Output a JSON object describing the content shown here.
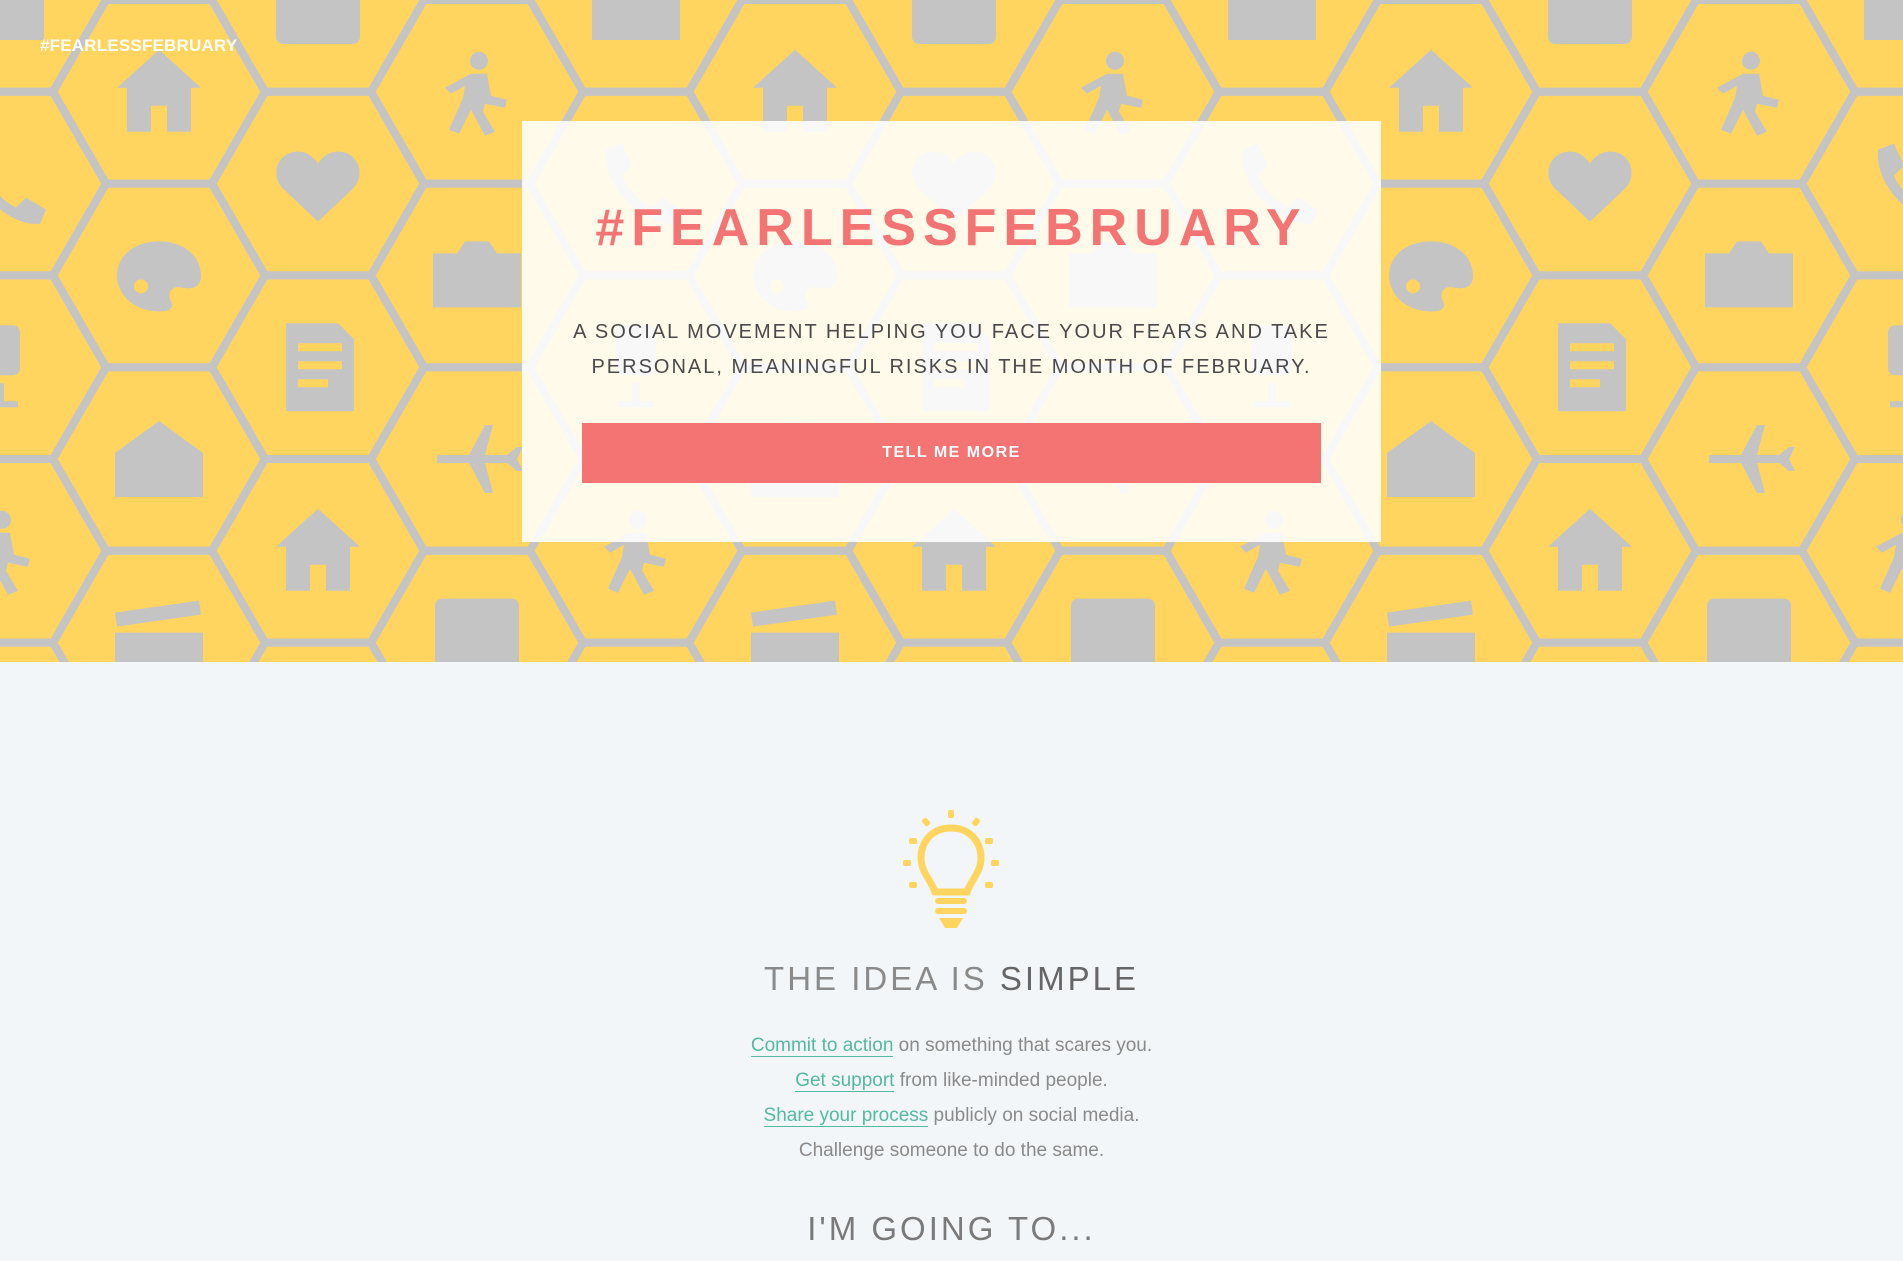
{
  "brand": "#FEARLESSFEBRUARY",
  "hero": {
    "title": "#FEARLESSFEBRUARY",
    "tagline": "A social movement helping you face your fears and take personal, meaningful risks in the month of February.",
    "cta": "TELL ME MORE",
    "pattern_icons": [
      "airplane-icon",
      "palette-icon",
      "walking-person-icon",
      "document-icon",
      "phone-icon",
      "music-note-icon",
      "envelope-icon",
      "camera-icon",
      "house-icon",
      "microphone-icon",
      "heart-icon",
      "clapperboard-icon"
    ]
  },
  "idea": {
    "heading_light": "THE IDEA IS",
    "heading_strong": "SIMPLE",
    "steps": [
      {
        "link": "Commit to action",
        "rest": " on something that scares you."
      },
      {
        "link": "Get support",
        "rest": " from like-minded people."
      },
      {
        "link": "Share your process",
        "rest": " publicly on social media."
      },
      {
        "link": "",
        "rest": "Challenge someone to do the same."
      }
    ],
    "going": "I'M GOING TO..."
  },
  "colors": {
    "hero_bg": "#ffd55f",
    "hex_line": "#c4c4c4",
    "accent": "#f47373",
    "link": "#55b8a3",
    "page_bg": "#f3f6f9"
  }
}
